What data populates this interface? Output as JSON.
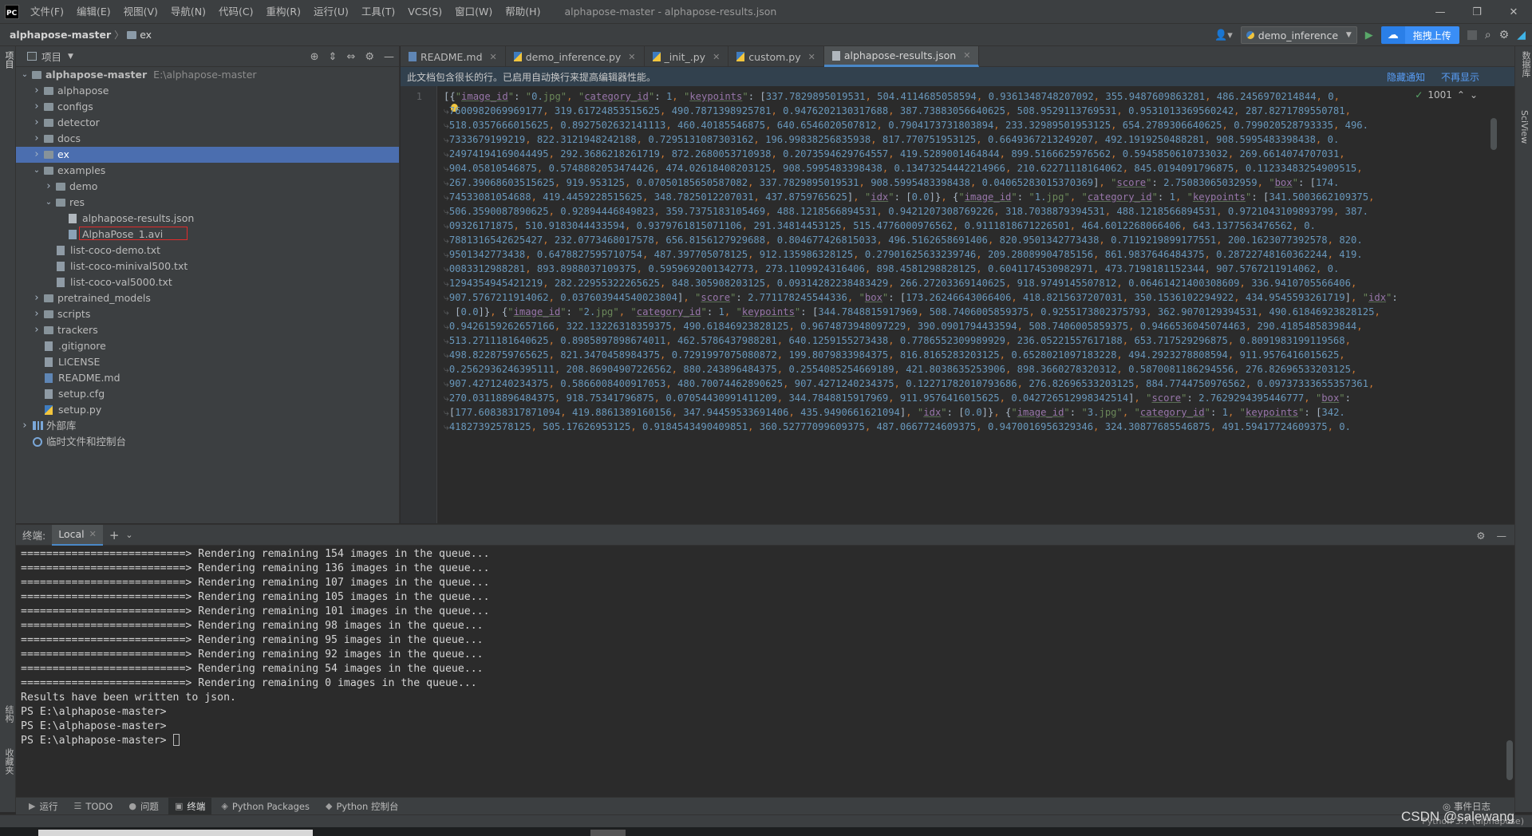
{
  "menubar": {
    "logo_text": "PC",
    "items": [
      "文件(F)",
      "编辑(E)",
      "视图(V)",
      "导航(N)",
      "代码(C)",
      "重构(R)",
      "运行(U)",
      "工具(T)",
      "VCS(S)",
      "窗口(W)",
      "帮助(H)"
    ],
    "window_title": "alphapose-master - alphapose-results.json",
    "controls": [
      "—",
      "❐",
      "✕"
    ]
  },
  "navbar": {
    "project": "alphapose-master",
    "folder": "ex",
    "run_config": "demo_inference",
    "upload_label": "拖拽上传"
  },
  "stripes": {
    "left_top": "项目",
    "left_bottom_1": "结构",
    "left_bottom_2": "收藏夹",
    "right_1": "数据库",
    "right_2": "SciView"
  },
  "project_panel": {
    "title": "项目",
    "tree": [
      {
        "label": "alphapose-master",
        "path": "E:\\alphapose-master",
        "arrow": "down",
        "icon": "folder",
        "depth": 0,
        "bold": true
      },
      {
        "label": "alphapose",
        "arrow": "right",
        "icon": "folder",
        "depth": 1
      },
      {
        "label": "configs",
        "arrow": "right",
        "icon": "folder",
        "depth": 1
      },
      {
        "label": "detector",
        "arrow": "right",
        "icon": "folder",
        "depth": 1
      },
      {
        "label": "docs",
        "arrow": "right",
        "icon": "folder",
        "depth": 1
      },
      {
        "label": "ex",
        "arrow": "right",
        "icon": "folder",
        "depth": 1,
        "selected": true
      },
      {
        "label": "examples",
        "arrow": "down",
        "icon": "folder",
        "depth": 1
      },
      {
        "label": "demo",
        "arrow": "right",
        "icon": "folder",
        "depth": 2
      },
      {
        "label": "res",
        "arrow": "down",
        "icon": "folder",
        "depth": 2
      },
      {
        "label": "alphapose-results.json",
        "arrow": "",
        "icon": "json",
        "depth": 3
      },
      {
        "label": "AlphaPose_1.avi",
        "arrow": "",
        "icon": "avi",
        "depth": 3,
        "highlight": true
      },
      {
        "label": "list-coco-demo.txt",
        "arrow": "",
        "icon": "txt",
        "depth": 2
      },
      {
        "label": "list-coco-minival500.txt",
        "arrow": "",
        "icon": "txt",
        "depth": 2
      },
      {
        "label": "list-coco-val5000.txt",
        "arrow": "",
        "icon": "txt",
        "depth": 2
      },
      {
        "label": "pretrained_models",
        "arrow": "right",
        "icon": "folder",
        "depth": 1
      },
      {
        "label": "scripts",
        "arrow": "right",
        "icon": "folder",
        "depth": 1
      },
      {
        "label": "trackers",
        "arrow": "right",
        "icon": "folder",
        "depth": 1
      },
      {
        "label": ".gitignore",
        "arrow": "",
        "icon": "txt",
        "depth": 1
      },
      {
        "label": "LICENSE",
        "arrow": "",
        "icon": "txt",
        "depth": 1
      },
      {
        "label": "README.md",
        "arrow": "",
        "icon": "md",
        "depth": 1
      },
      {
        "label": "setup.cfg",
        "arrow": "",
        "icon": "cfg",
        "depth": 1
      },
      {
        "label": "setup.py",
        "arrow": "",
        "icon": "py",
        "depth": 1
      },
      {
        "label": "外部库",
        "arrow": "right",
        "icon": "libs",
        "depth": 0
      },
      {
        "label": "临时文件和控制台",
        "arrow": "",
        "icon": "scratch",
        "depth": 0
      }
    ]
  },
  "editor": {
    "tabs": [
      {
        "label": "README.md",
        "icon": "md",
        "active": false
      },
      {
        "label": "demo_inference.py",
        "icon": "py",
        "active": false
      },
      {
        "label": "_init_.py",
        "icon": "py",
        "active": false
      },
      {
        "label": "custom.py",
        "icon": "py",
        "active": false
      },
      {
        "label": "alphapose-results.json",
        "icon": "json",
        "active": true
      }
    ],
    "notice": "此文档包含很长的行。已启用自动换行来提高编辑器性能。",
    "notice_hide": "隐藏通知",
    "notice_dismiss": "不再显示",
    "line_number": "1",
    "inspection_count": "1001",
    "code_lines": [
      "[{\"image_id\": \"0.jpg\", \"category_id\": 1, \"keypoints\": [337.7829895019531, 504.4114685058594, 0.9361348748207092, 355.9487609863281, 486.2456970214844, 0,",
      ".7600982069969177, 319.61724853515625, 490.7871398925781, 0.9476202130317688, 387.73883056640625, 508.9529113769531, 0.9531013369560242, 287.8271789550781,",
      ".518.0357666015625, 0.8927502632141113, 460.40185546875, 640.6546020507812, 0.7904173731803894, 233.32989501953125, 654.2789306640625, 0.799020528793335, 496.",
      ".7333679199219, 822.3121948242188, 0.7295131087303162, 196.99838256835938, 817.770751953125, 0.6649367213249207, 492.1919250488281, 908.5995483398438, 0.",
      ".24974194169044495, 292.3686218261719, 872.2680053710938, 0.2073594629764557, 419.5289001464844, 899.5166625976562, 0.5945850610733032, 269.6614074707031,",
      ".904.05810546875, 0.5748882053474426, 474.02618408203125, 908.5995483398438, 0.13473254442214966, 210.62271118164062, 845.0194091796875, 0.11233483254909515,",
      ".267.39068603515625, 919.953125, 0.07050185650587082, 337.7829895019531, 908.5995483398438, 0.04065283015370369], \"score\": 2.75083065032959, \"box\": [174.",
      ".74533081054688, 419.4459228515625, 348.7825012207031, 437.8759765625], \"idx\": [0.0]}, {\"image_id\": \"1.jpg\", \"category_id\": 1, \"keypoints\": [341.5003662109375,",
      ".506.3590087890625, 0.92894446849823, 359.7375183105469, 488.1218566894531, 0.9421207308769226, 318.7038879394531, 488.1218566894531, 0.9721043109893799, 387.",
      ".09326171875, 510.9183044433594, 0.9379761815071106, 291.34814453125, 515.4776000976562, 0.9111818671226501, 464.6012268066406, 643.1377563476562, 0.",
      ".7881316542625427, 232.0773468017578, 656.8156127929688, 0.804677426815033, 496.5162658691406, 820.9501342773438, 0.7119219899177551, 200.1623077392578, 820.",
      ".9501342773438, 0.6478827595710754, 487.397705078125, 912.135986328125, 0.27901625633239746, 209.28089904785156, 861.9837646484375, 0.28722748160362244, 419.",
      ".0083312988281, 893.8988037109375, 0.5959692001342773, 273.1109924316406, 898.4581298828125, 0.6041174530982971, 473.7198181152344, 907.5767211914062, 0.",
      ".1294354945421219, 282.22955322265625, 848.305908203125, 0.09314282238483429, 266.27203369140625, 918.9749145507812, 0.06461421400308609, 336.9410705566406,",
      ".907.5767211914062, 0.037603944540023804], \"score\": 2.771178245544336, \"box\": [173.26246643066406, 418.8215637207031, 350.1536102294922, 434.9545593261719], \"idx\":",
      ". [0.0]}, {\"image_id\": \"2.jpg\", \"category_id\": 1, \"keypoints\": [344.7848815917969, 508.7406005859375, 0.9255173802375793, 362.9070129394531, 490.61846923828125,",
      ".0.9426159262657166, 322.13226318359375, 490.61846923828125, 0.9674873948097229, 390.0901794433594, 508.7406005859375, 0.9466536045074463, 290.4185485839844,",
      ".513.2711181640625, 0.8985897898674011, 462.5786437988281, 640.1259155273438, 0.7786552309989929, 236.05221557617188, 653.717529296875, 0.8091983199119568,",
      ".498.8228759765625, 821.3470458984375, 0.7291997075080872, 199.8079833984375, 816.8165283203125, 0.6528021097183228, 494.2923278808594, 911.9576416015625,",
      ".0.2562936246395111, 208.86904907226562, 880.243896484375, 0.2554085254669189, 421.8038635253906, 898.3660278320312, 0.5870081186294556, 276.82696533203125,",
      ".907.4271240234375, 0.5866008400917053, 480.70074462890625, 907.4271240234375, 0.12271782010793686, 276.82696533203125, 884.7744750976562, 0.09737333655357361,",
      ".270.03118896484375, 918.75341796875, 0.07054430991411209, 344.7848815917969, 911.9576416015625, 0.042726512998342514], \"score\": 2.7629294395446777, \"box\":",
      ".[177.60838317871094, 419.8861389160156, 347.94459533691406, 435.9490661621094], \"idx\": [0.0]}, {\"image_id\": \"3.jpg\", \"category_id\": 1, \"keypoints\": [342.",
      ".41827392578125, 505.17626953125, 0.9184543490409851, 360.52777099609375, 487.0667724609375, 0.9470016956329346, 324.30877685546875, 491.59417724609375, 0."
    ]
  },
  "terminal": {
    "title": "终端:",
    "tab": "Local",
    "lines": [
      "==========================> Rendering remaining 154 images in the queue...",
      "==========================> Rendering remaining 136 images in the queue...",
      "==========================> Rendering remaining 107 images in the queue...",
      "==========================> Rendering remaining 105 images in the queue...",
      "==========================> Rendering remaining 101 images in the queue...",
      "==========================> Rendering remaining 98 images in the queue...",
      "==========================> Rendering remaining 95 images in the queue...",
      "==========================> Rendering remaining 92 images in the queue...",
      "==========================> Rendering remaining 54 images in the queue...",
      "==========================> Rendering remaining 0 images in the queue...",
      "Results have been written to json.",
      "PS E:\\alphapose-master>",
      "PS E:\\alphapose-master>",
      "PS E:\\alphapose-master> "
    ]
  },
  "bottom_tools": [
    {
      "label": "运行",
      "icon": "▶"
    },
    {
      "label": "TODO",
      "icon": "☰"
    },
    {
      "label": "问题",
      "icon": "●"
    },
    {
      "label": "终端",
      "icon": "▣",
      "active": true
    },
    {
      "label": "Python Packages",
      "icon": "◈"
    },
    {
      "label": "Python 控制台",
      "icon": "◆"
    }
  ],
  "event_log": "事件日志",
  "status_right": "Python 3.7 (alphapose)",
  "watermark": "CSDN @salewang"
}
